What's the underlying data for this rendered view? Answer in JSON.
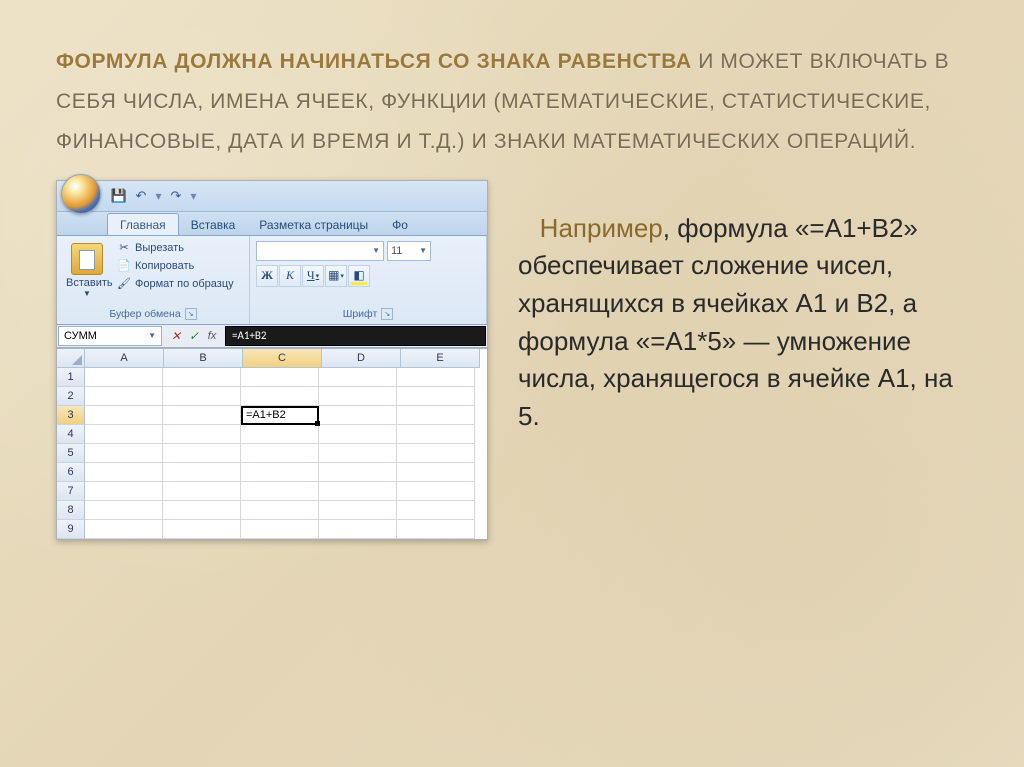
{
  "heading": {
    "bold": "ФОРМУЛА ДОЛЖНА НАЧИНАТЬСЯ СО ЗНАКА РАВЕНСТВА",
    "rest1": " И МОЖЕТ ВКЛЮЧАТЬ В СЕБЯ ЧИСЛА, ИМЕНА ЯЧЕЕК, ФУНКЦИИ (МАТЕМАТИЧЕСКИЕ, СТАТИСТИЧЕСКИЕ, ФИНАНСОВЫЕ, ДАТА И ВРЕМЯ И Т.Д.) И ЗНАКИ МАТЕМАТИЧЕСКИХ ОПЕРАЦИЙ."
  },
  "excel": {
    "qat": {
      "save_glyph": "💾",
      "undo_glyph": "↶",
      "redo_glyph": "↷",
      "dd_glyph": "▾"
    },
    "tabs": {
      "home": "Главная",
      "insert": "Вставка",
      "layout": "Разметка страницы",
      "formulas_cut": "Фо"
    },
    "clipboard": {
      "paste": "Вставить",
      "cut": "Вырезать",
      "copy": "Копировать",
      "format_painter": "Формат по образцу",
      "group_label": "Буфер обмена",
      "cut_glyph": "✂",
      "copy_glyph": "📄",
      "brush_glyph": "🖌"
    },
    "font": {
      "name_placeholder": "",
      "size": "11",
      "bold": "Ж",
      "italic": "К",
      "underline": "Ч",
      "group_label": "Шрифт"
    },
    "formula_bar": {
      "name_box": "СУММ",
      "cancel_glyph": "✕",
      "enter_glyph": "✓",
      "fx": "fx",
      "formula": "=A1+B2"
    },
    "grid": {
      "cols": [
        "A",
        "B",
        "C",
        "D",
        "E"
      ],
      "rows": [
        "1",
        "2",
        "3",
        "4",
        "5",
        "6",
        "7",
        "8",
        "9"
      ],
      "active_cell_value": "=A1+B2",
      "active_col_index": 2,
      "active_row_index": 2
    }
  },
  "paragraph": {
    "lead": "Например",
    "rest": ", формула «=А1+В2» обеспечивает сложение чисел, хранящихся в ячейках А1 и В2, а формула «=А1*5» — умножение числа, хранящегося в ячейке А1, на 5."
  }
}
